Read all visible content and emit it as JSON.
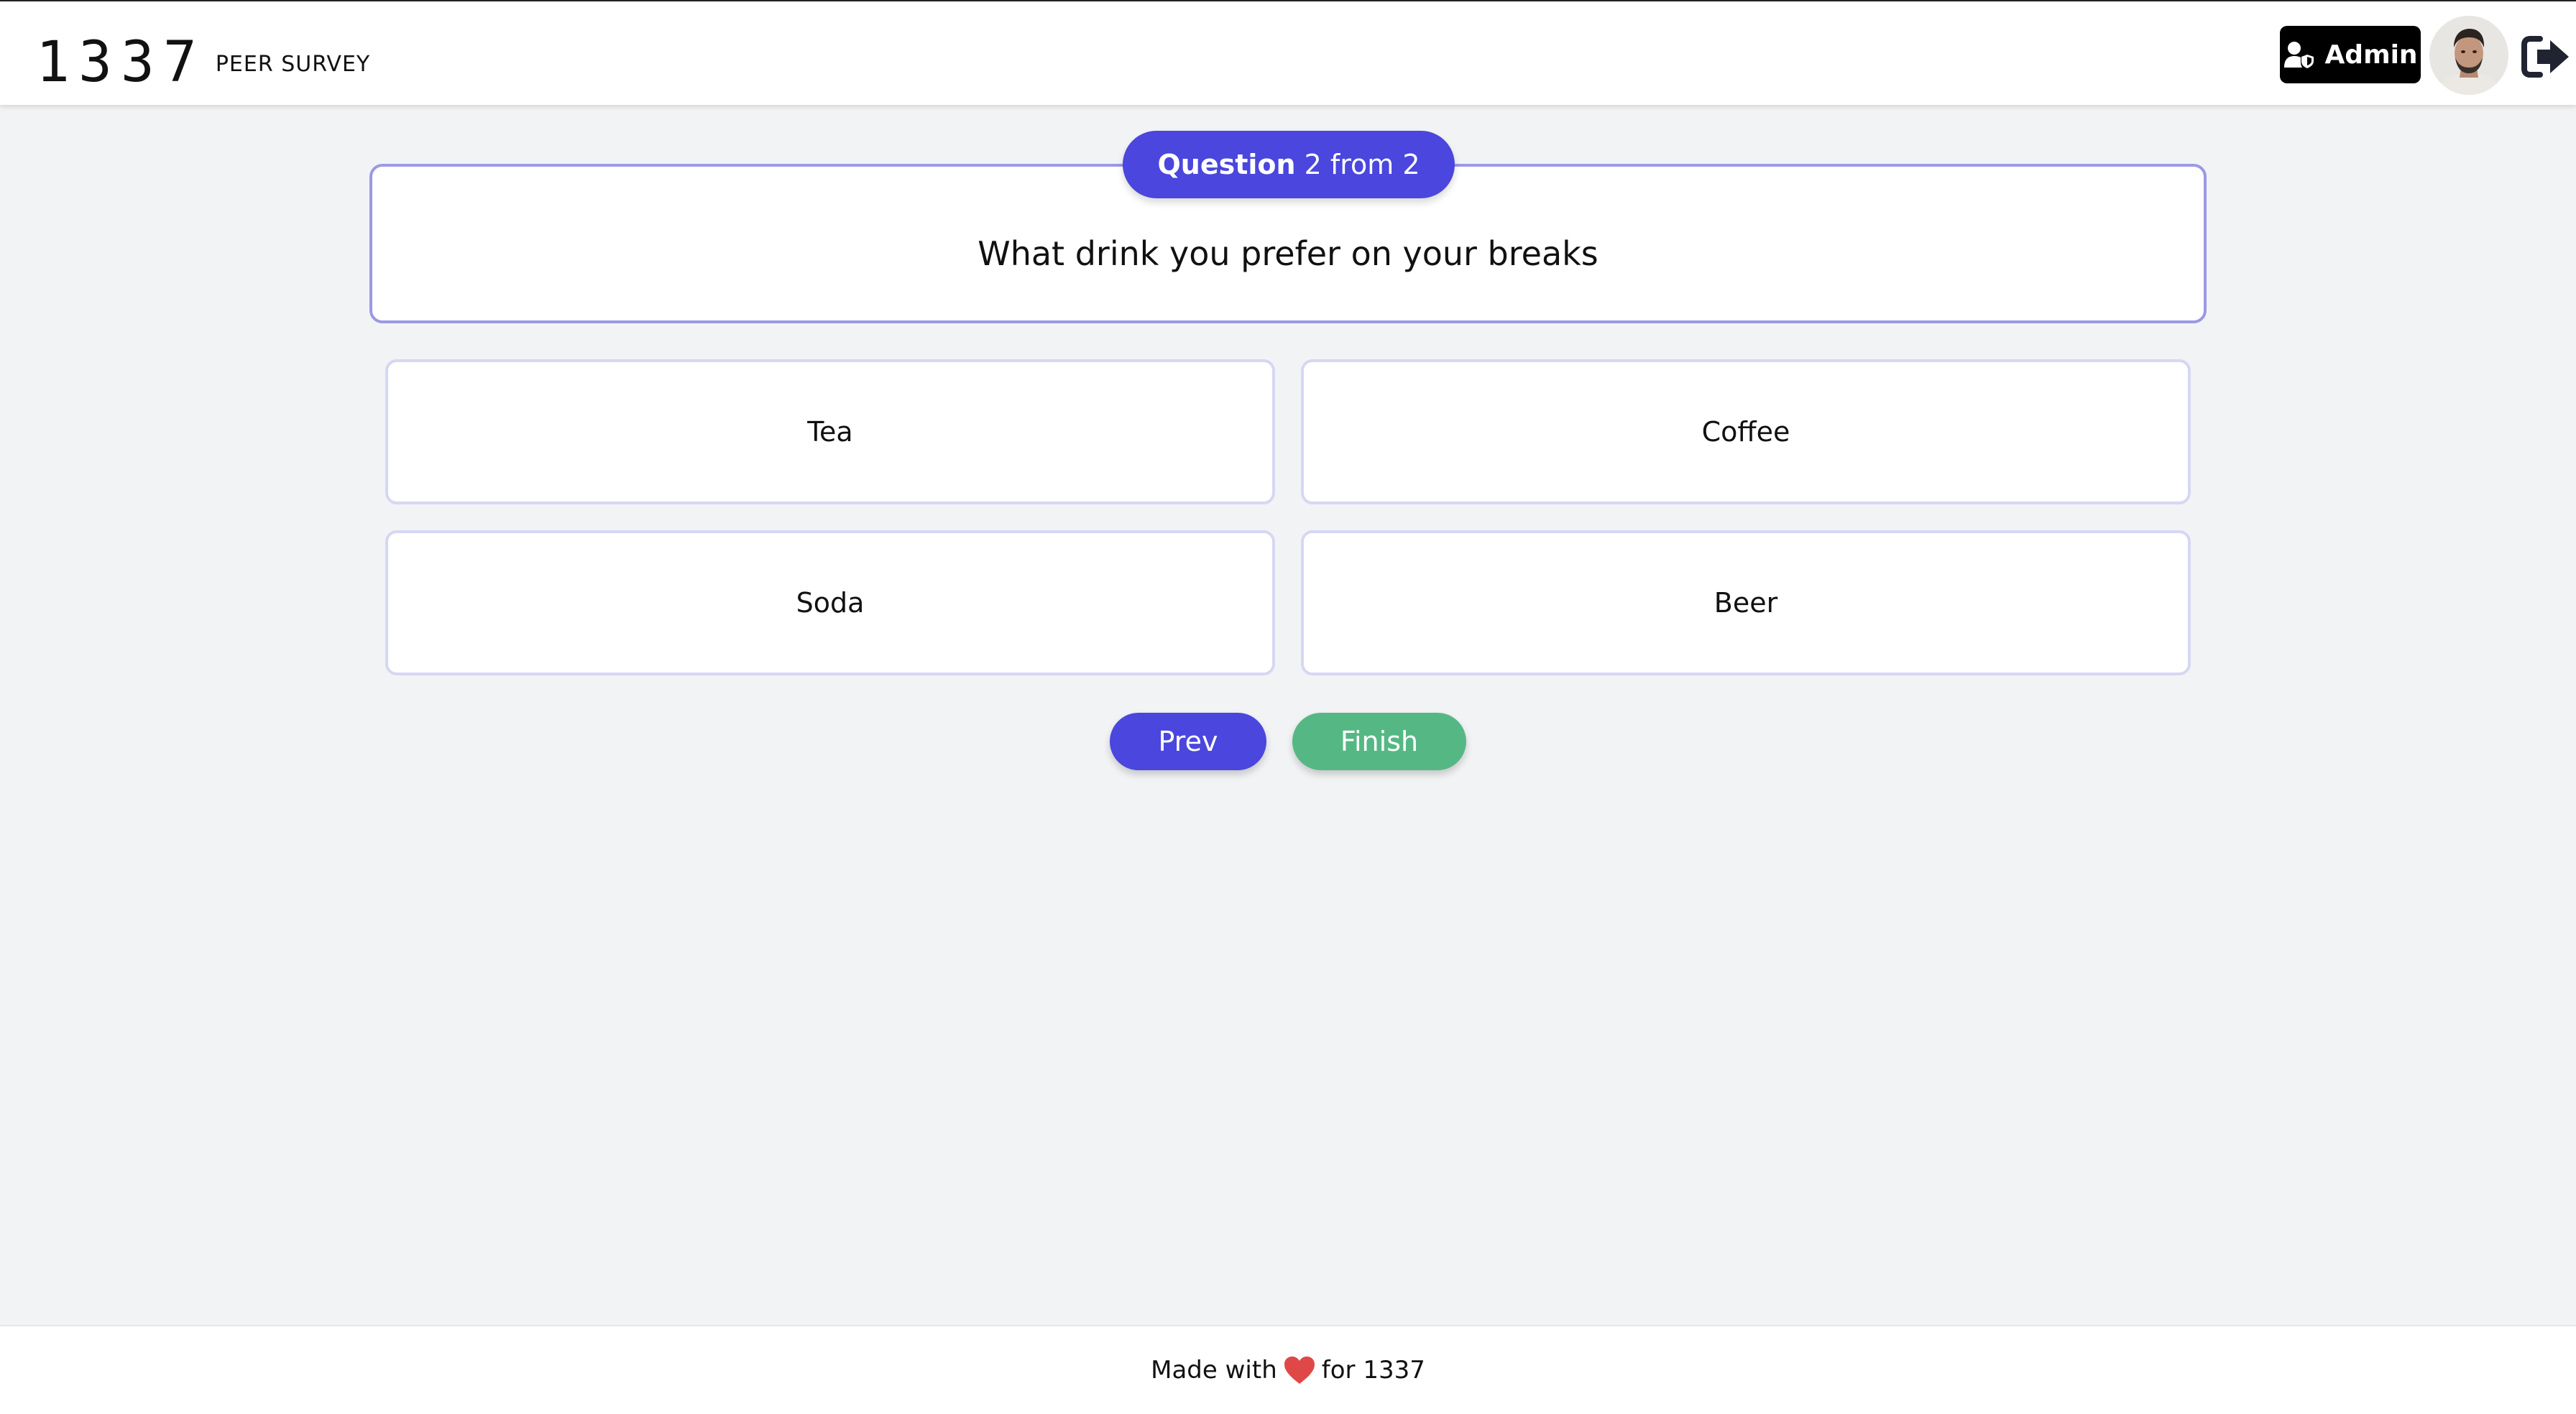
{
  "header": {
    "logo_mark": "1337",
    "logo_text": "PEER SURVEY",
    "admin_label": "Admin",
    "admin_icon": "user-shield-icon",
    "avatar_icon": "user-avatar",
    "logout_icon": "logout-icon"
  },
  "question": {
    "label": "Question",
    "progress": "2 from 2",
    "current": 2,
    "total": 2,
    "text": "What drink you prefer on your breaks"
  },
  "options": [
    {
      "label": "Tea"
    },
    {
      "label": "Coffee"
    },
    {
      "label": "Soda"
    },
    {
      "label": "Beer"
    }
  ],
  "nav": {
    "prev_label": "Prev",
    "finish_label": "Finish"
  },
  "footer": {
    "before": "Made with",
    "heart_icon": "heart-icon",
    "after": "for 1337"
  },
  "colors": {
    "accent": "#4a46de",
    "finish": "#55b884",
    "heart": "#e04848",
    "page_bg": "#f2f3f5"
  }
}
